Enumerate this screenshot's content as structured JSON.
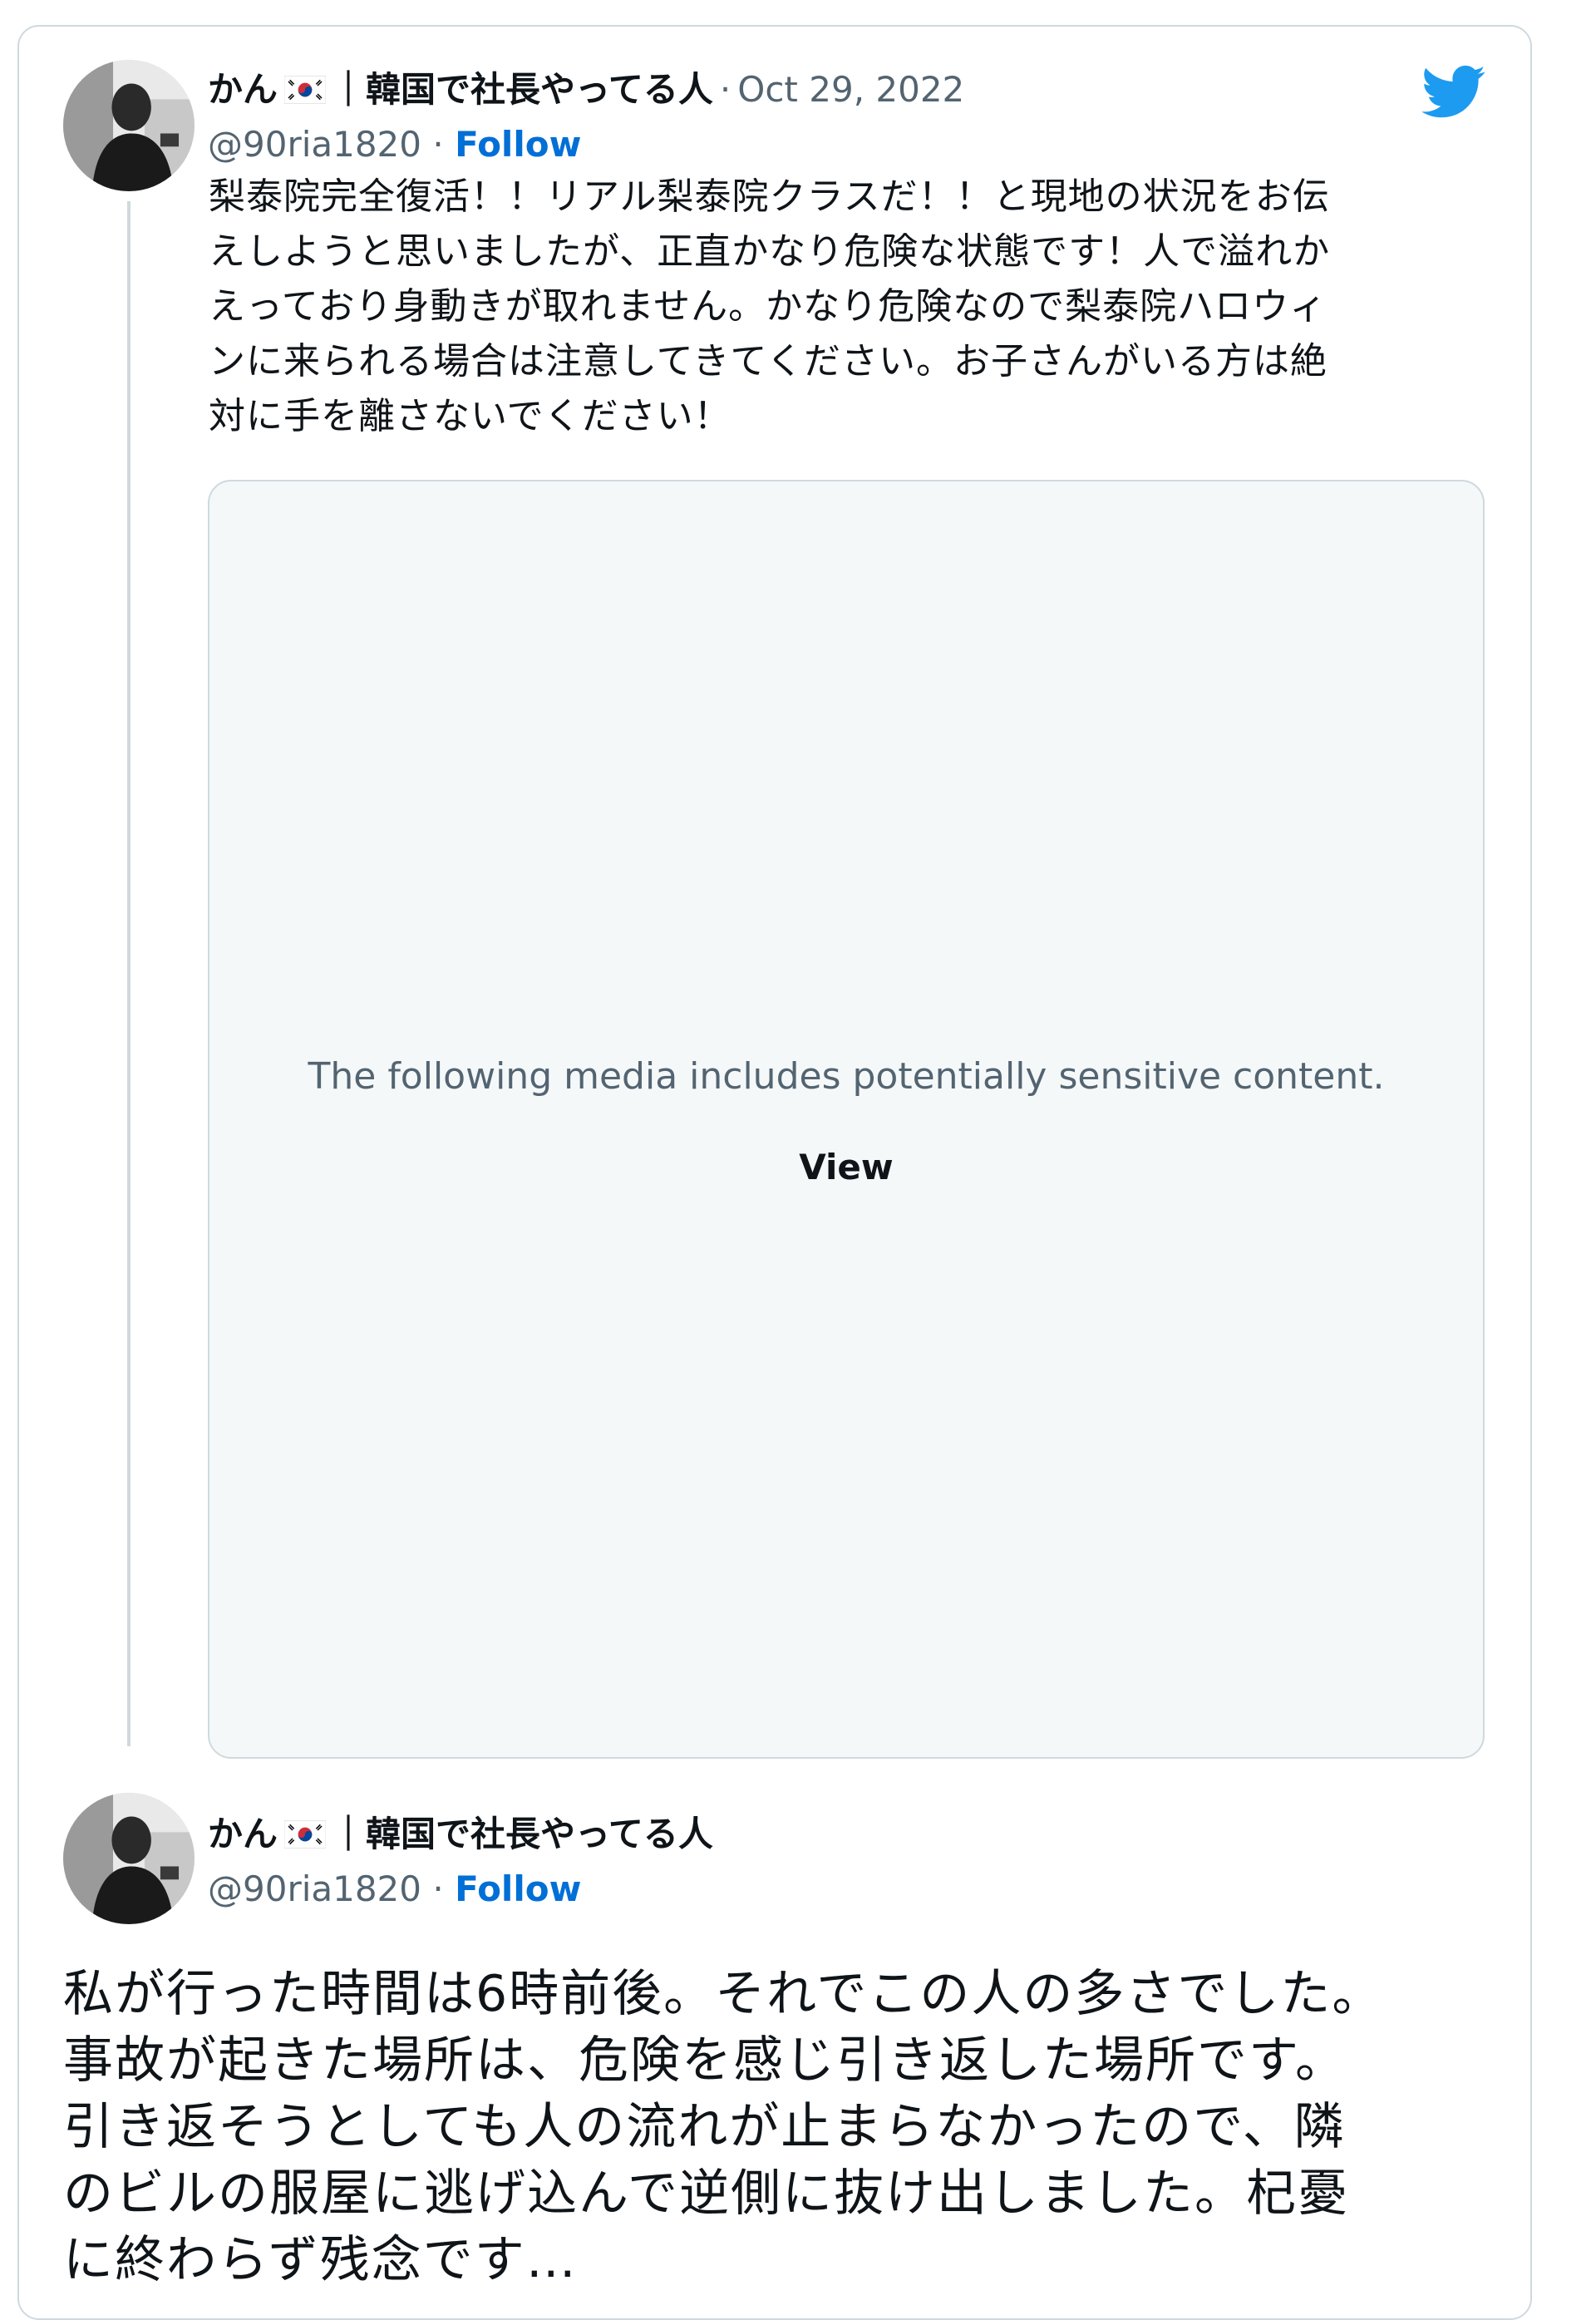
{
  "brand": {
    "accent_color": "#1d9bf0",
    "follow_color": "#006fd6",
    "logo_icon": "twitter-bird-icon"
  },
  "tweet1": {
    "display_name": "かん",
    "flag_icon": "south-korea-flag-icon",
    "name_suffix": "｜韓国で社長やってる人",
    "date_separator": "·",
    "date": "Oct 29, 2022",
    "handle": "@90ria1820",
    "handle_separator": "·",
    "follow_label": "Follow",
    "text_lines": [
      "梨泰院完全復活！！リアル梨泰院クラスだ！！と現地の状況をお伝",
      "えしようと思いましたが、正直かなり危険な状態です！人で溢れか",
      "えっており身動きが取れません。かなり危険なので梨泰院ハロウィ",
      "ンに来られる場合は注意してきてください。お子さんがいる方は絶",
      "対に手を離さないでください！"
    ],
    "media": {
      "warning_text": "The following media includes potentially sensitive content.",
      "view_label": "View"
    }
  },
  "tweet2": {
    "display_name": "かん",
    "flag_icon": "south-korea-flag-icon",
    "name_suffix": "｜韓国で社長やってる人",
    "handle": "@90ria1820",
    "handle_separator": "·",
    "follow_label": "Follow",
    "text_lines": [
      "私が行った時間は6時前後。それでこの人の多さでした。",
      "事故が起きた場所は、危険を感じ引き返した場所です。",
      "引き返そうとしても人の流れが止まらなかったので、隣",
      "のビルの服屋に逃げ込んで逆側に抜け出しました。杞憂",
      "に終わらず残念です…"
    ]
  }
}
